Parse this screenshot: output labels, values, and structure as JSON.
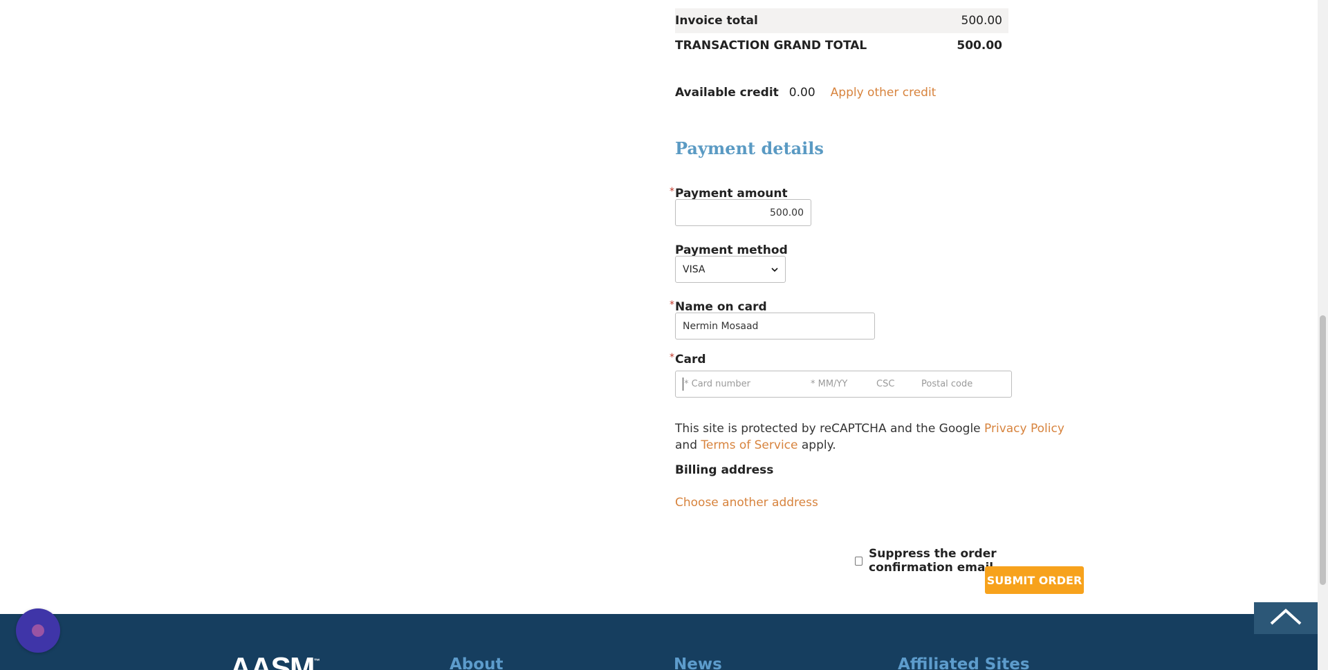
{
  "totals": {
    "invoice_total_label": "Invoice total",
    "invoice_total_value": "500.00",
    "grand_total_label": "TRANSACTION GRAND TOTAL",
    "grand_total_value": "500.00"
  },
  "credit": {
    "label": "Available credit",
    "value": "0.00",
    "apply_link": "Apply other credit"
  },
  "payment": {
    "section_title": "Payment details",
    "required_marker": "*",
    "amount_label": "Payment amount",
    "amount_value": "500.00",
    "method_label": "Payment method",
    "method_selected": "VISA",
    "name_label": "Name on card",
    "name_value": "Nermin Mosaad",
    "card_label": "Card",
    "card_number_placeholder": "* Card number",
    "card_expiry_placeholder": "* MM/YY",
    "card_csc_placeholder": "CSC",
    "card_postal_placeholder": "Postal code"
  },
  "recaptcha": {
    "prefix": "This site is protected by reCAPTCHA and the Google ",
    "privacy_link": "Privacy Policy",
    "middle": " and ",
    "terms_link": "Terms of Service",
    "suffix": " apply."
  },
  "billing": {
    "label": "Billing address",
    "choose_link": "Choose another address"
  },
  "order": {
    "suppress_label": "Suppress the order confirmation email",
    "suppress_checked": false,
    "submit_label": "SUBMIT ORDER"
  },
  "footer": {
    "logo_text": "AASM",
    "logo_mark": "™",
    "columns": [
      "About",
      "News",
      "Affiliated Sites"
    ]
  },
  "colors": {
    "accent_link": "#d7833d",
    "section_title": "#5a9ac3",
    "submit_button": "#f7a21c",
    "footer_bg": "#163e5f",
    "footer_heading": "#5d9ccc",
    "chat_bubble": "#3f35a8"
  },
  "icons": {
    "chat": "chat-bubble-icon",
    "back_to_top": "chevron-up-icon",
    "select": "chevron-down-icon"
  }
}
